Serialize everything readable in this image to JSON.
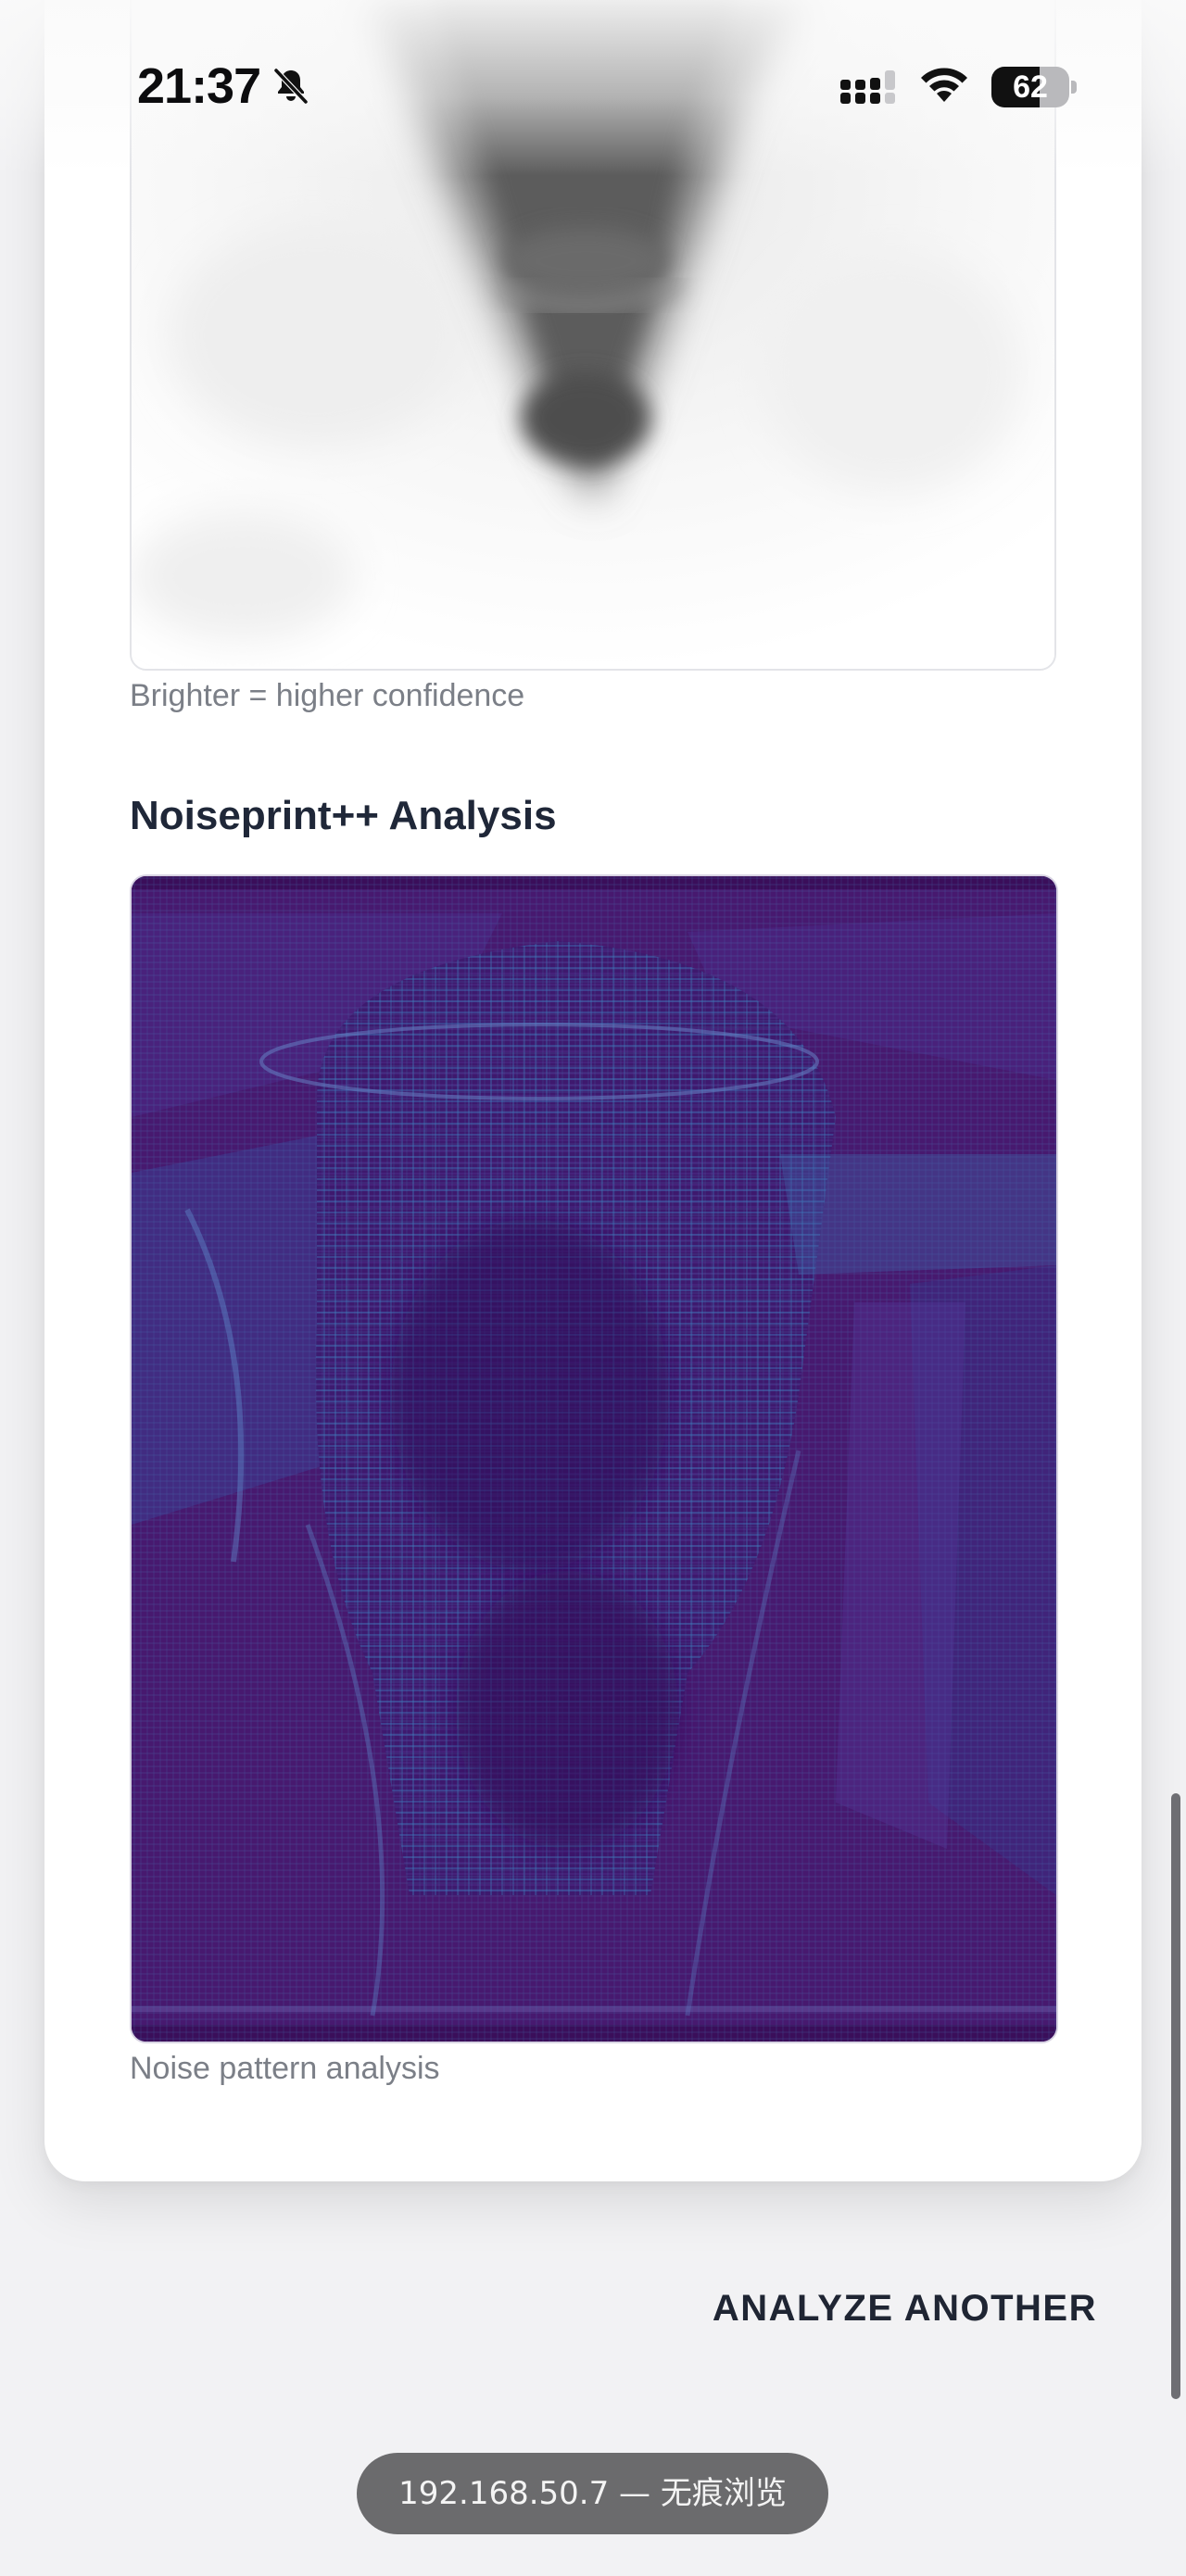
{
  "status_bar": {
    "time": "21:37",
    "battery": "62",
    "battery_level": 0.62,
    "icons": [
      "bell-slash-icon",
      "cellular-signal-icon",
      "wifi-icon",
      "battery-icon"
    ]
  },
  "results": {
    "heatmap_caption": "Brighter = higher confidence",
    "noiseprint_title": "Noiseprint++ Analysis",
    "noiseprint_caption": "Noise pattern analysis"
  },
  "actions": {
    "analyze_another": "ANALYZE ANOTHER"
  },
  "browser": {
    "url_pill": "192.168.50.7 — 无痕浏览"
  },
  "colors": {
    "noise_base": "#46196f",
    "noise_highlight": "#3b6fb0",
    "card_bg": "#ffffff",
    "page_bg": "#f2f2f4",
    "title_text": "#1f2738",
    "caption_text": "#7b7f87"
  }
}
